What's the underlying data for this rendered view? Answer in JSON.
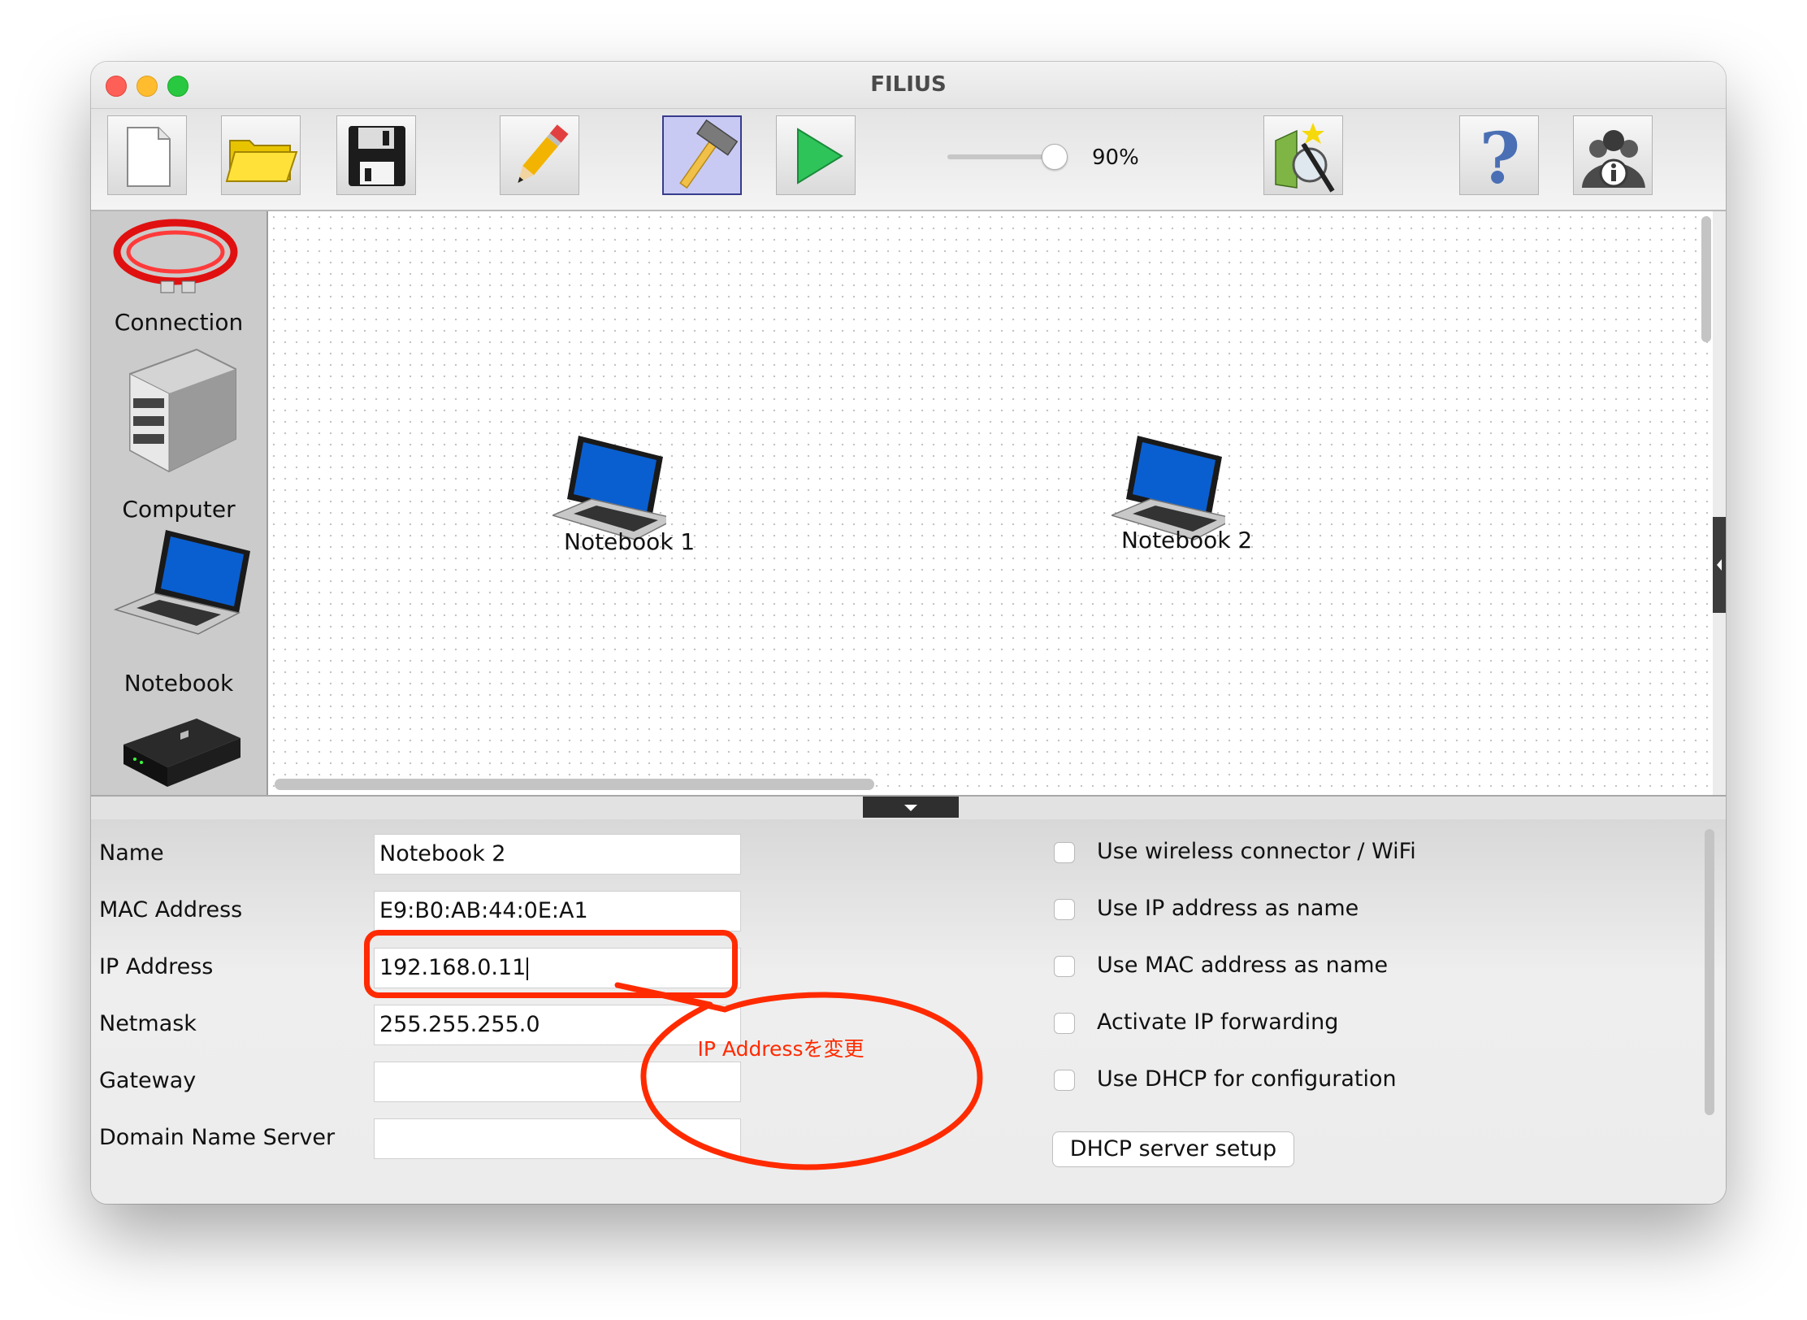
{
  "window": {
    "title": "FILIUS"
  },
  "toolbar": {
    "buttons": [
      {
        "name": "new",
        "icon": "new-file-icon"
      },
      {
        "name": "open",
        "icon": "folder-icon"
      },
      {
        "name": "save",
        "icon": "floppy-disk-icon"
      },
      {
        "name": "edit",
        "icon": "pencil-icon"
      },
      {
        "name": "design-mode",
        "icon": "hammer-icon",
        "active": true
      },
      {
        "name": "simulation",
        "icon": "play-icon"
      },
      {
        "name": "wizard",
        "icon": "magic-wand-icon"
      },
      {
        "name": "help",
        "icon": "question-mark-icon"
      },
      {
        "name": "info",
        "icon": "info-group-icon"
      }
    ],
    "zoom": {
      "label": "90%",
      "value_percent": 90
    }
  },
  "palette": {
    "items": [
      {
        "label": "Connection",
        "icon": "cable-icon"
      },
      {
        "label": "Computer",
        "icon": "server-icon"
      },
      {
        "label": "Notebook",
        "icon": "notebook-icon"
      },
      {
        "label": "",
        "icon": "switch-icon"
      }
    ]
  },
  "canvas": {
    "nodes": [
      {
        "label": "Notebook 1",
        "icon": "notebook-icon"
      },
      {
        "label": "Notebook 2",
        "icon": "notebook-icon"
      }
    ]
  },
  "properties": {
    "fields": [
      {
        "label": "Name",
        "value": "Notebook 2"
      },
      {
        "label": "MAC Address",
        "value": "E9:B0:AB:44:0E:A1"
      },
      {
        "label": "IP Address",
        "value": "192.168.0.11"
      },
      {
        "label": "Netmask",
        "value": "255.255.255.0"
      },
      {
        "label": "Gateway",
        "value": ""
      },
      {
        "label": "Domain Name Server",
        "value": ""
      }
    ],
    "checkboxes": [
      {
        "label": "Use wireless connector / WiFi",
        "checked": false
      },
      {
        "label": "Use IP address as name",
        "checked": false
      },
      {
        "label": "Use MAC address as name",
        "checked": false
      },
      {
        "label": "Activate IP forwarding",
        "checked": false
      },
      {
        "label": "Use DHCP for configuration",
        "checked": false
      }
    ],
    "dhcp_button": "DHCP server setup"
  },
  "annotation": {
    "text": "IP Addressを変更",
    "color": "#ff2a00"
  }
}
